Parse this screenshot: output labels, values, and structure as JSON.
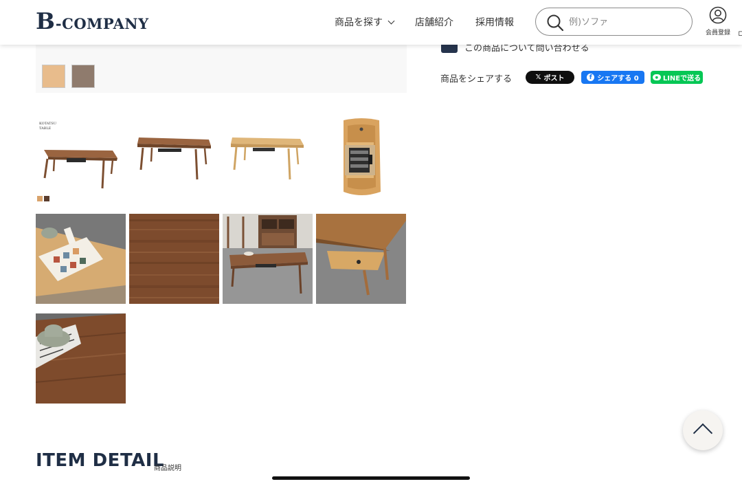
{
  "header": {
    "logo_mark": "B",
    "logo_text": "-COMPANY",
    "nav": {
      "find_products": "商品を探す",
      "store_intro": "店舗紹介",
      "recruit": "採用情報"
    },
    "search": {
      "placeholder": "例)ソファ",
      "value": ""
    },
    "member_label": "会員登録",
    "cut_label": "ロ"
  },
  "product": {
    "swatch_colors": [
      "#e8bc8c",
      "#8f7b6d"
    ],
    "inquiry_text": "この商品について問い合わせる",
    "share": {
      "label": "商品をシェアする",
      "x_post": "ポスト",
      "x_mark": "𝕏",
      "facebook": "シェアする 0",
      "line": "LINEで送る"
    }
  },
  "gallery": {
    "kotatsu_caption_line1": "KOTATSU",
    "kotatsu_caption_line2": "TABLE"
  },
  "detail": {
    "title": "ITEM DETAIL",
    "subtitle": "商品説明"
  },
  "colors": {
    "navy": "#1f2e45",
    "walnut": "#8a5a3c",
    "oak": "#d9b078",
    "line_green": "#06c755",
    "facebook_blue": "#1877f2"
  }
}
